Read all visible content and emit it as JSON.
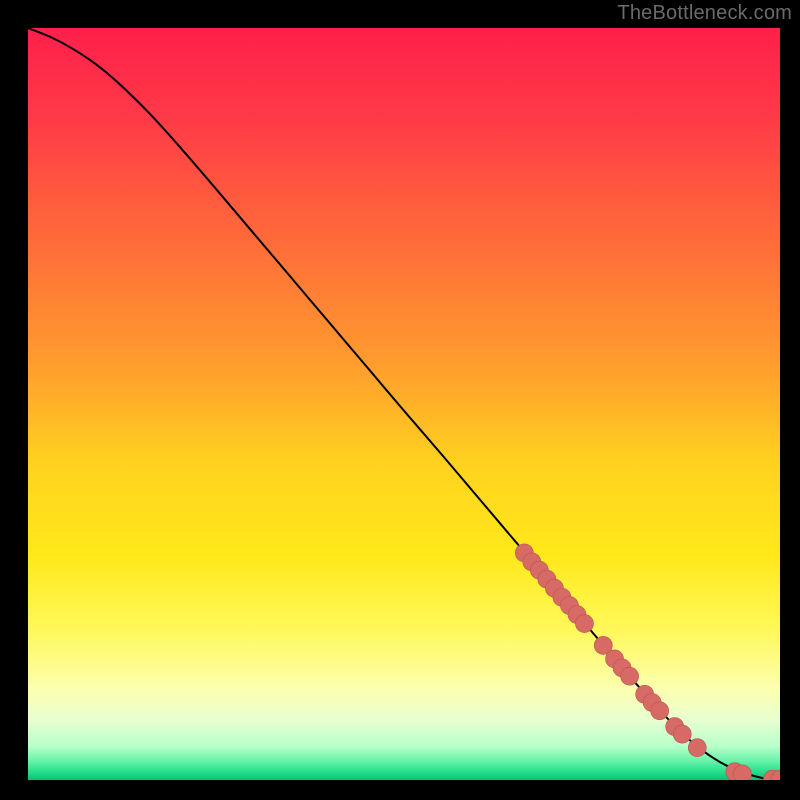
{
  "watermark": "TheBottleneck.com",
  "colors": {
    "page_bg": "#000000",
    "curve": "#000000",
    "marker_fill": "#d86a66",
    "marker_stroke": "#b85450"
  },
  "gradient_stops": [
    {
      "offset": 0.0,
      "color": "#ff1f4b"
    },
    {
      "offset": 0.12,
      "color": "#ff3a47"
    },
    {
      "offset": 0.28,
      "color": "#ff6a3a"
    },
    {
      "offset": 0.44,
      "color": "#ff9a2e"
    },
    {
      "offset": 0.58,
      "color": "#ffd21f"
    },
    {
      "offset": 0.7,
      "color": "#ffe81a"
    },
    {
      "offset": 0.8,
      "color": "#fff85a"
    },
    {
      "offset": 0.88,
      "color": "#fcffb0"
    },
    {
      "offset": 0.92,
      "color": "#e8ffd0"
    },
    {
      "offset": 0.955,
      "color": "#b8ffca"
    },
    {
      "offset": 0.975,
      "color": "#66f3a8"
    },
    {
      "offset": 0.99,
      "color": "#22dd8a"
    },
    {
      "offset": 1.0,
      "color": "#0fbf72"
    }
  ],
  "chart_data": {
    "type": "line",
    "title": "",
    "xlabel": "",
    "ylabel": "",
    "xlim": [
      0,
      100
    ],
    "ylim": [
      0,
      100
    ],
    "series": [
      {
        "name": "curve",
        "x": [
          0,
          3,
          6,
          9,
          12,
          16,
          20,
          25,
          30,
          35,
          40,
          45,
          50,
          55,
          60,
          65,
          70,
          75,
          80,
          84,
          86,
          88,
          90,
          92,
          94,
          96,
          98,
          100
        ],
        "y": [
          100,
          98.8,
          97.2,
          95.2,
          92.7,
          88.8,
          84.4,
          78.6,
          72.7,
          66.8,
          60.9,
          55.0,
          49.1,
          43.3,
          37.4,
          31.5,
          25.6,
          19.7,
          13.8,
          9.3,
          7.2,
          5.3,
          3.7,
          2.4,
          1.4,
          0.7,
          0.2,
          0.1
        ]
      }
    ],
    "markers": [
      {
        "x": 66.0,
        "y": 30.2
      },
      {
        "x": 67.0,
        "y": 29.0
      },
      {
        "x": 68.0,
        "y": 27.9
      },
      {
        "x": 69.0,
        "y": 26.7
      },
      {
        "x": 70.0,
        "y": 25.5
      },
      {
        "x": 71.0,
        "y": 24.3
      },
      {
        "x": 72.0,
        "y": 23.2
      },
      {
        "x": 73.0,
        "y": 22.0
      },
      {
        "x": 74.0,
        "y": 20.8
      },
      {
        "x": 76.5,
        "y": 17.9
      },
      {
        "x": 78.0,
        "y": 16.1
      },
      {
        "x": 79.0,
        "y": 14.9
      },
      {
        "x": 80.0,
        "y": 13.8
      },
      {
        "x": 82.0,
        "y": 11.4
      },
      {
        "x": 83.0,
        "y": 10.3
      },
      {
        "x": 84.0,
        "y": 9.2
      },
      {
        "x": 86.0,
        "y": 7.1
      },
      {
        "x": 87.0,
        "y": 6.1
      },
      {
        "x": 89.0,
        "y": 4.3
      },
      {
        "x": 94.0,
        "y": 1.1
      },
      {
        "x": 95.0,
        "y": 0.8
      },
      {
        "x": 99.0,
        "y": 0.1
      },
      {
        "x": 100.0,
        "y": 0.1
      }
    ],
    "marker_radius_x_units": 1.2
  }
}
